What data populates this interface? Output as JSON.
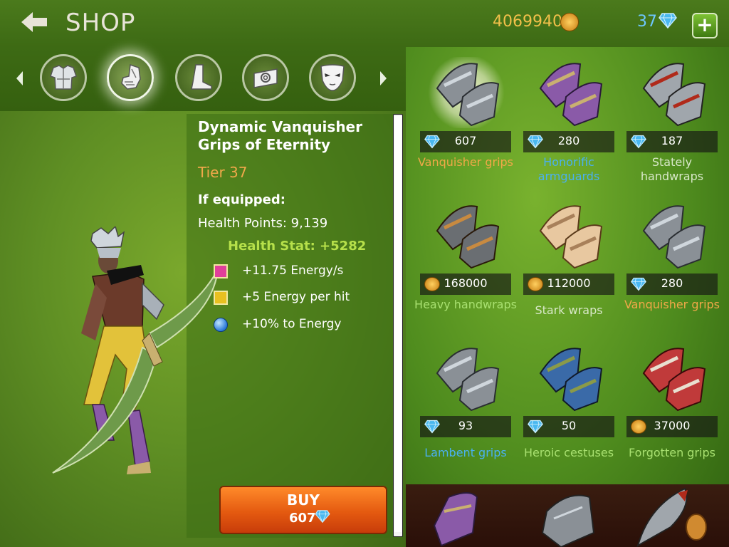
{
  "header": {
    "title": "SHOP",
    "gold": "4069940",
    "gems": "37",
    "plus_label": "+"
  },
  "categories": [
    {
      "icon": "chest-armor-icon",
      "selected": false
    },
    {
      "icon": "gauntlet-icon",
      "selected": true
    },
    {
      "icon": "boot-icon",
      "selected": false
    },
    {
      "icon": "ring-icon",
      "selected": false
    },
    {
      "icon": "mask-icon",
      "selected": false
    }
  ],
  "detail": {
    "name": "Dynamic Vanquisher Grips of Eternity",
    "tier": "Tier 37",
    "if_equipped": "If equipped:",
    "health_points": "Health Points: 9,139",
    "health_stat": "Health Stat: +5282",
    "bonuses": [
      {
        "icon": "magenta-gem-icon",
        "text": "+11.75 Energy/s"
      },
      {
        "icon": "yellow-gem-icon",
        "text": "+5 Energy per hit"
      },
      {
        "icon": "blue-orb-icon",
        "text": "+10% to Energy"
      }
    ]
  },
  "buy": {
    "label": "BUY",
    "price": "607"
  },
  "items": [
    {
      "name": "Vanquisher grips",
      "price": "607",
      "currency": "gem",
      "name_color": "orange",
      "style": "steel"
    },
    {
      "name": "Honorific armguards",
      "price": "280",
      "currency": "gem",
      "name_color": "blue",
      "style": "purple"
    },
    {
      "name": "Stately handwraps",
      "price": "187",
      "currency": "gem",
      "name_color": "grey",
      "style": "blade"
    },
    {
      "name": "Heavy handwraps",
      "price": "168000",
      "currency": "gold",
      "name_color": "green",
      "style": "bronze"
    },
    {
      "name": "Stark wraps",
      "price": "112000",
      "currency": "gold",
      "name_color": "grey",
      "style": "wraps"
    },
    {
      "name": "Vanquisher grips",
      "price": "280",
      "currency": "gem",
      "name_color": "orange",
      "style": "steel"
    },
    {
      "name": "Lambent grips",
      "price": "93",
      "currency": "gem",
      "name_color": "blue",
      "style": "steel"
    },
    {
      "name": "Heroic cestuses",
      "price": "50",
      "currency": "gem",
      "name_color": "green",
      "style": "blue"
    },
    {
      "name": "Forgotten grips",
      "price": "37000",
      "currency": "gold",
      "name_color": "green",
      "style": "red"
    }
  ],
  "colors": {
    "gold_text": "#f2c04a",
    "gem_text": "#6ec6ff",
    "tier_text": "#f0a84a",
    "health_stat_text": "#b6e04a",
    "buy_button": "#e45a10"
  }
}
